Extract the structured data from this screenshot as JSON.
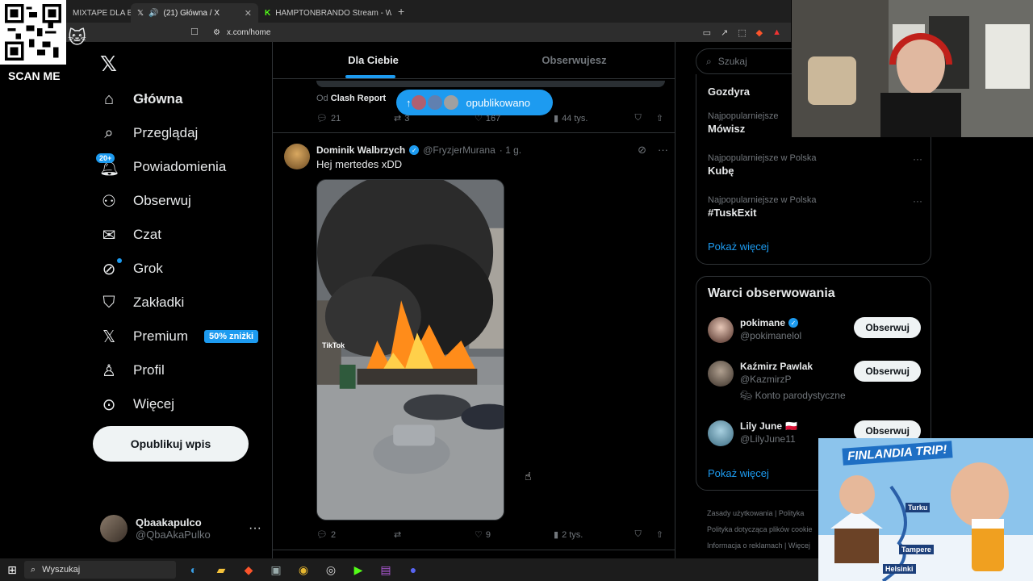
{
  "browser": {
    "tabs": [
      {
        "label": "MIXTAPE DLA BEZRO",
        "active": false
      },
      {
        "label": "(21) Główna / X",
        "active": true
      },
      {
        "label": "HAMPTONBRANDO Stream - Watch",
        "active": false
      }
    ],
    "url": "x.com/home"
  },
  "overlay": {
    "scan_label": "SCAN ME"
  },
  "nav": {
    "items": [
      {
        "label": "Główna",
        "icon": "home-icon"
      },
      {
        "label": "Przeglądaj",
        "icon": "search-icon"
      },
      {
        "label": "Powiadomienia",
        "icon": "bell-icon"
      },
      {
        "label": "Obserwuj",
        "icon": "person-plus-icon"
      },
      {
        "label": "Czat",
        "icon": "mail-icon"
      },
      {
        "label": "Grok",
        "icon": "grok-icon"
      },
      {
        "label": "Zakładki",
        "icon": "bookmark-icon"
      },
      {
        "label": "Premium",
        "icon": "x-icon"
      },
      {
        "label": "Profil",
        "icon": "person-icon"
      },
      {
        "label": "Więcej",
        "icon": "more-circle-icon"
      }
    ],
    "notif_badge": "20+",
    "premium_promo": "50% zniżki",
    "post_button": "Opublikuj wpis",
    "account": {
      "name": "Qbaakapulco",
      "handle": "@QbaAkaPulko"
    }
  },
  "feed": {
    "tabs": [
      "Dla Ciebie",
      "Obserwujesz"
    ],
    "prev_tweet": {
      "repost_prefix": "Od",
      "repost_source": "Clash Report",
      "stats": {
        "replies": "21",
        "reposts": "3",
        "likes": "167",
        "views": "44 tys."
      }
    },
    "new_posts_pill": "opublikowano",
    "tweet": {
      "name": "Dominik Walbrzych",
      "handle": "@FryzjerMurana",
      "time": "· 1 g.",
      "text": "Hej mertedes xDD",
      "video_watermark": "TikTok",
      "stats": {
        "replies": "2",
        "reposts": "",
        "likes": "9",
        "views": "2 tys."
      }
    }
  },
  "right": {
    "search_placeholder": "Szukaj",
    "trends": [
      {
        "context": "",
        "title": "Gozdyra"
      },
      {
        "context": "Najpopularniejsze",
        "title": "Mówisz"
      },
      {
        "context": "Najpopularniejsze w Polska",
        "title": "Kubę"
      },
      {
        "context": "Najpopularniejsze w Polska",
        "title": "#TuskExit"
      }
    ],
    "show_more": "Pokaż więcej",
    "wtf_title": "Warci obserwowania",
    "who_to_follow": [
      {
        "name": "pokimane",
        "handle": "@pokimanelol",
        "note": "",
        "verified": true,
        "flag": ""
      },
      {
        "name": "Kaźmirz Pawlak",
        "handle": "@KazmirzP",
        "note": "Konto parodystyczne",
        "verified": false,
        "flag": ""
      },
      {
        "name": "Lily June",
        "handle": "@LilyJune11",
        "note": "",
        "verified": false,
        "flag": "🇵🇱"
      }
    ],
    "follow_label": "Obserwuj",
    "footer": [
      "Zasady użytkowania",
      "Polityka",
      "Polityka dotycząca plików cookie",
      "Informacja o reklamach",
      "Więcej"
    ]
  },
  "thumbnail": {
    "title": "FINLANDIA TRIP!",
    "cities": [
      "Turku",
      "Tampere",
      "Helsinki"
    ]
  },
  "taskbar": {
    "search_placeholder": "Wyszukaj"
  },
  "colors": {
    "accent": "#1d9bf0",
    "background": "#000000",
    "border": "#2f3336",
    "muted": "#71767b"
  }
}
